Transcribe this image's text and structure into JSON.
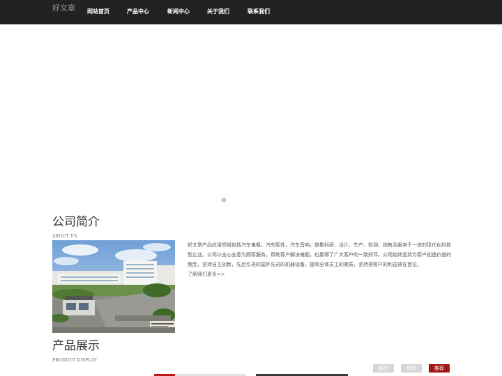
{
  "header": {
    "logo": "好文章",
    "nav": [
      {
        "label": "网站首页"
      },
      {
        "label": "产品中心"
      },
      {
        "label": "新闻中心"
      },
      {
        "label": "关于我们"
      },
      {
        "label": "联系我们"
      }
    ]
  },
  "about": {
    "title": "公司简介",
    "subtitle": "ABOUT US",
    "text": "好文章产品应用领域包括汽车电瓶，汽车配件，汽车音响。是集科研、设计、生产、检测、销售及服务于一体的现代化科技型企业。公司以全心全意为顾客服务，帮助客户解决难题，也赢得了广大客户的一致好评。公司始终坚持为客户创造价值的理念，坚持自主创新，先后引进的国外先进的机器设备，提高全体员工的素质，坚持把客户的利益放在首位。",
    "more": "了解我们更多>>",
    "image_sign": "嘉兴市某某实业有限公司"
  },
  "products": {
    "title": "产品展示",
    "subtitle": "PRODUCT DISPLAY",
    "tabs": [
      {
        "label": "新品",
        "color": "#d6d6d6"
      },
      {
        "label": "热销",
        "color": "#d6d6d6"
      },
      {
        "label": "推荐",
        "color": "#a01818"
      }
    ]
  },
  "colors": {
    "topbar": "#222222",
    "accent": "#a01818"
  }
}
